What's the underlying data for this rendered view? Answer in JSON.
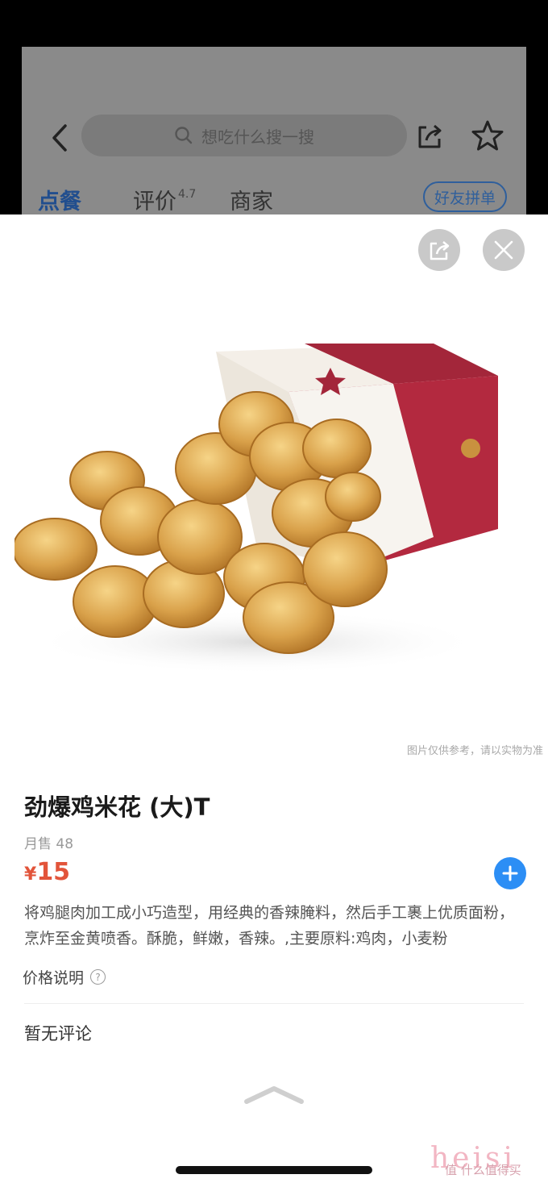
{
  "background_app": {
    "search_placeholder": "想吃什么搜一搜",
    "tabs": [
      {
        "label": "点餐"
      },
      {
        "label": "评价",
        "rating": "4.7"
      },
      {
        "label": "商家"
      }
    ],
    "group_order_button": "好友拼单"
  },
  "product": {
    "image_note": "图片仅供参考，请以实物为准",
    "name": "劲爆鸡米花 (大)T",
    "monthly_sales": "月售 48",
    "price_symbol": "¥",
    "price": "15",
    "description": "将鸡腿肉加工成小巧造型，用经典的香辣腌料，然后手工裹上优质面粉，烹炸至金黄喷香。酥脆，鲜嫩，香辣。,主要原料:鸡肉，小麦粉",
    "price_note": "价格说明",
    "help_symbol": "?"
  },
  "reviews": {
    "empty_text": "暂无评论"
  },
  "watermark": {
    "text": "heisi",
    "sub": "值 什么值得买"
  },
  "colors": {
    "price": "#e2543a",
    "add_button": "#2c8ef5",
    "active_tab": "#214e8e"
  }
}
